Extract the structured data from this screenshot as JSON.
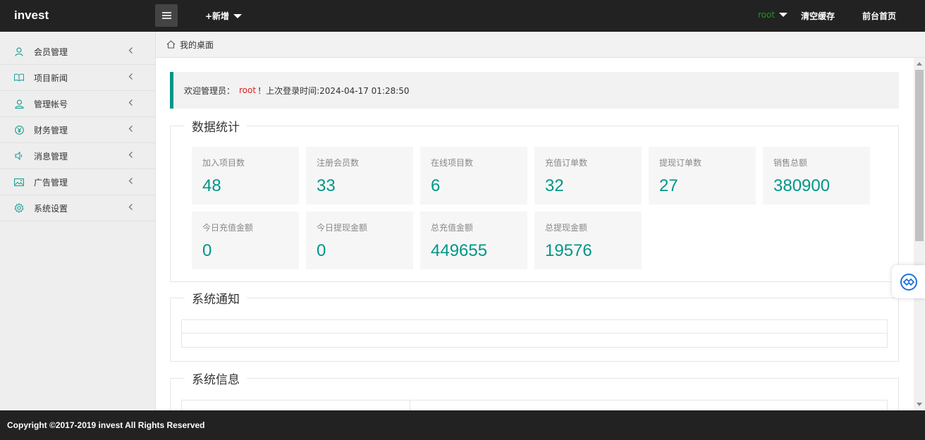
{
  "header": {
    "logo": "invest",
    "add_new": "+新增",
    "username": "root",
    "clear_cache": "清空缓存",
    "front_home": "前台首页"
  },
  "sidebar": {
    "items": [
      {
        "label": "会员管理",
        "icon": "user-icon"
      },
      {
        "label": "项目新闻",
        "icon": "book-icon"
      },
      {
        "label": "管理帐号",
        "icon": "admin-icon"
      },
      {
        "label": "财务管理",
        "icon": "yen-icon"
      },
      {
        "label": "消息管理",
        "icon": "speaker-icon"
      },
      {
        "label": "广告管理",
        "icon": "image-icon"
      },
      {
        "label": "系统设置",
        "icon": "gear-icon"
      }
    ]
  },
  "breadcrumb": {
    "home": "我的桌面"
  },
  "welcome": {
    "prefix": "欢迎管理员：",
    "username": "root",
    "suffix": "！上次登录时间:2024-04-17 01:28:50"
  },
  "stats": {
    "title": "数据统计",
    "items": [
      {
        "label": "加入项目数",
        "value": "48"
      },
      {
        "label": "注册会员数",
        "value": "33"
      },
      {
        "label": "在线项目数",
        "value": "6"
      },
      {
        "label": "充值订单数",
        "value": "32"
      },
      {
        "label": "提现订单数",
        "value": "27"
      },
      {
        "label": "销售总额",
        "value": "380900"
      },
      {
        "label": "今日充值金额",
        "value": "0"
      },
      {
        "label": "今日提现金额",
        "value": "0"
      },
      {
        "label": "总充值金额",
        "value": "449655"
      },
      {
        "label": "总提现金额",
        "value": "19576"
      }
    ]
  },
  "notice": {
    "title": "系统通知"
  },
  "sysinfo": {
    "title": "系统信息"
  },
  "footer": {
    "copyright": "Copyright ©2017-2019 invest All Rights Reserved"
  },
  "colors": {
    "accent": "#009688",
    "username_top": "#1a9a1a",
    "username_welcome": "#e02020"
  }
}
